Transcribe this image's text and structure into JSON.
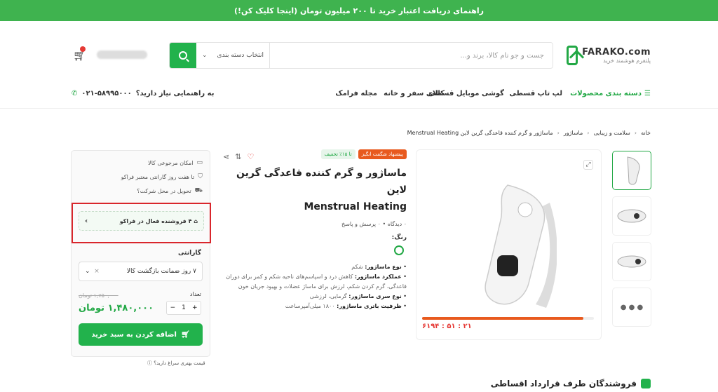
{
  "banner": {
    "text": "راهنمای دریافت اعتبار خرید تا ۲۰۰ میلیون تومان (اینجا کلیک کن!)"
  },
  "logo": {
    "name": "FARAKO.com",
    "tagline": "پلتفرم هوشمند خرید"
  },
  "search": {
    "placeholder": "جست و جو نام کالا، برند و...",
    "category_label": "انتخاب دسته بندی",
    "search_icon": "search-icon"
  },
  "header": {
    "cart_icon": "cart-icon"
  },
  "nav": {
    "categories": "دسته بندی محصولات",
    "items": [
      "لپ تاپ قسطی",
      "گوشی موبایل قسطی",
      "کالای سفر و خانه",
      "مجله فرامک"
    ],
    "help_text": "به راهنمایی نیاز دارید؟",
    "phone": "۰۲۱-۵۸۹۹۵۰۰۰"
  },
  "breadcrumb": [
    "خانه",
    "سلامت و زیبایی",
    "ماساژور",
    "ماساژور و گرم کننده قاعدگی گرین لاین Menstrual Heating"
  ],
  "gallery": {
    "timer": "۶۱۹۴ : ۵۱ : ۲۱",
    "timer_progress": 0.94,
    "more_icon": "more-icon"
  },
  "product": {
    "badge_hot": "پیشنهاد شگفت انگیز",
    "badge_discount": "تا ۱۵٪ تخفیف",
    "title_line1": "ماساژور و گرم کننده قاعدگی گرین لاین",
    "title_line2": "Menstrual Heating",
    "meta": "۰ دیدگاه • ۰ پرسش و پاسخ",
    "color_label": "رنگ:",
    "specs": [
      {
        "k": "نوع ماساژور:",
        "v": "شکم"
      },
      {
        "k": "عملکرد ماساژور:",
        "v": "کاهش درد و اسپاسم‌های ناحیه شکم و کمر برای دوران قاعدگی، گرم کردن شکم، لرزش برای ماساژ عضلات و بهبود جریان خون"
      },
      {
        "k": "نوع سری ماساژور:",
        "v": "گرمایی، لرزشی"
      },
      {
        "k": "ظرفیت باتری ماساژور:",
        "v": "۱۸۰۰ میلی‌آمپرساعت"
      }
    ]
  },
  "buybox": {
    "perks": [
      "امکان مرجوعی کالا",
      "تا هفت روز گارانتی معتبر فراکو",
      "تحویل در محل شرکت؟"
    ],
    "sellers": "۴ فروشنده فعال در فراکو",
    "warranty_label": "گارانتی",
    "warranty_value": "۷ روز ضمانت بازگشت کالا",
    "old_price": "۱,۷۵۰,۰۰۰ تومان",
    "qty_label": "تعداد",
    "qty": "1",
    "price": "۱,۴۸۰,۰۰۰ تومان",
    "add_to_cart": "اضافه کردن به سبد خرید",
    "better_price": "قیمت بهتری سراغ دارید؟"
  },
  "section": {
    "title": "فروشندگان طرف قرارداد اقساطی"
  },
  "colors": {
    "brand": "#22b24c",
    "banner": "#3fb34f",
    "timer": "#e85a1e",
    "highlight": "#d9262c"
  }
}
